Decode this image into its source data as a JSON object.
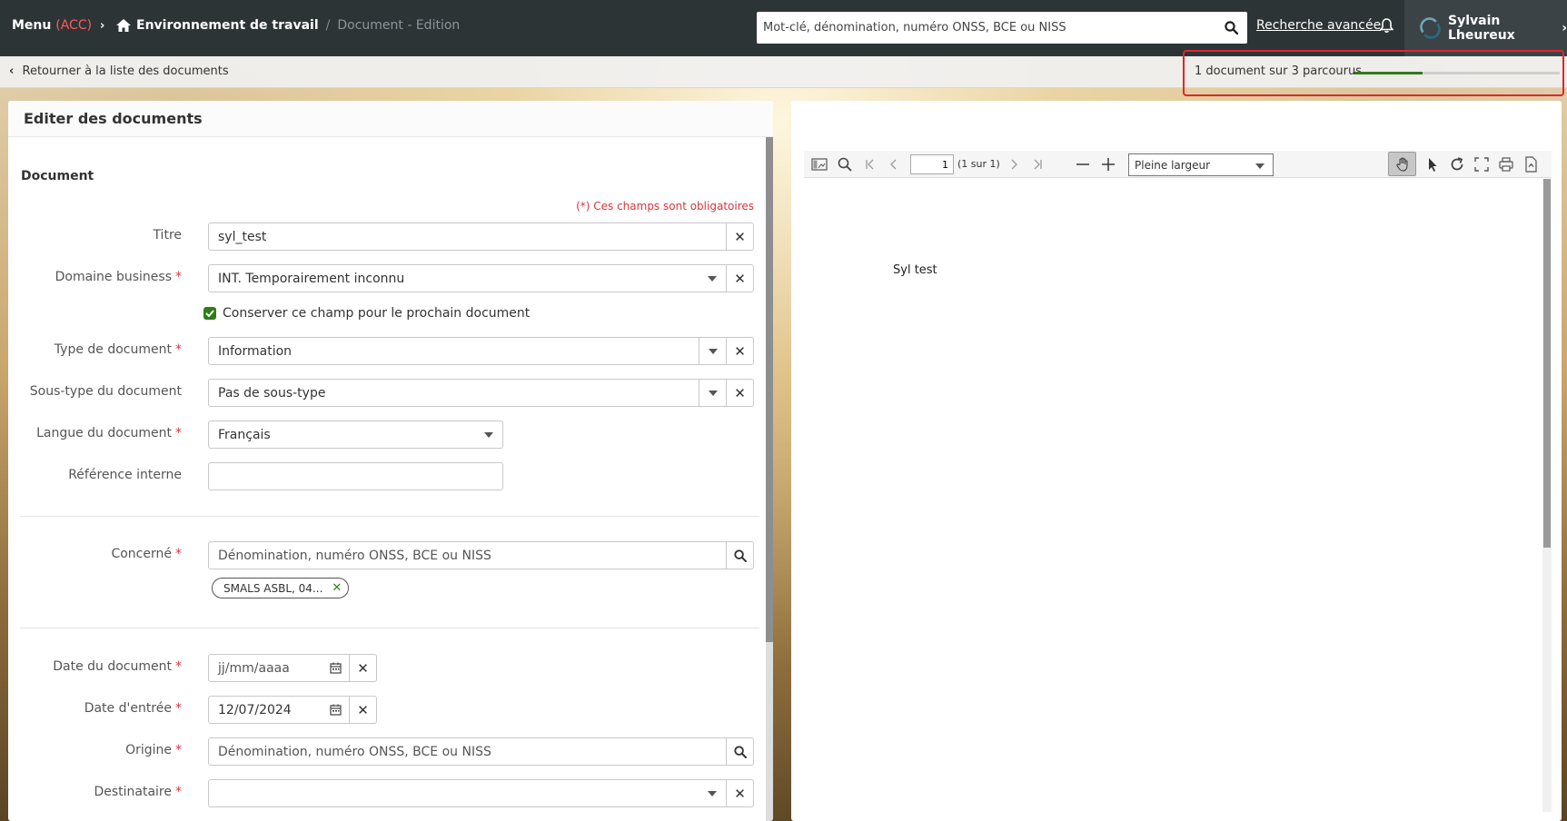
{
  "topbar": {
    "menu_label": "Menu",
    "env_tag": "(ACC)",
    "breadcrumb_workspace": "Environnement de travail",
    "breadcrumb_separator": "/",
    "breadcrumb_current": "Document - Edition",
    "search_placeholder": "Mot-clé, dénomination, numéro ONSS, BCE ou NISS",
    "advanced_search": "Recherche avancée",
    "user_name": "Sylvain Lheureux"
  },
  "subbar": {
    "back_label": "Retourner à la liste des documents",
    "progress_text": "1 document sur 3 parcourus",
    "progress_fraction": 0.3333,
    "progress_color": "#2e7d1a"
  },
  "form": {
    "panel_title": "Editer des documents",
    "section_title": "Document",
    "required_note": "(*) Ces champs sont obligatoires",
    "required_marker": "*",
    "fields": {
      "titre": {
        "label": "Titre",
        "value": "syl_test"
      },
      "domaine": {
        "label": "Domaine business",
        "value": "INT. Temporairement inconnu"
      },
      "keep_field": {
        "label": "Conserver ce champ pour le prochain document",
        "checked": true
      },
      "type": {
        "label": "Type de document",
        "value": "Information"
      },
      "sous_type": {
        "label": "Sous-type du document",
        "value": "Pas de sous-type"
      },
      "langue": {
        "label": "Langue du document",
        "value": "Français"
      },
      "reference": {
        "label": "Référence interne",
        "value": ""
      },
      "concerne": {
        "label": "Concerné",
        "placeholder": "Dénomination, numéro ONSS, BCE ou NISS",
        "tag": "SMALS ASBL, 04..."
      },
      "date_document": {
        "label": "Date du document",
        "placeholder": "jj/mm/aaaa"
      },
      "date_entree": {
        "label": "Date d'entrée",
        "value": "12/07/2024"
      },
      "origine": {
        "label": "Origine",
        "placeholder": "Dénomination, numéro ONSS, BCE ou NISS"
      },
      "destinataire": {
        "label": "Destinataire",
        "value": ""
      }
    }
  },
  "viewer": {
    "page_number": "1",
    "page_of": "(1 sur 1)",
    "zoom_level": "Pleine largeur",
    "document_text": "Syl test"
  },
  "colors": {
    "accent_green": "#2e7d1a",
    "required_red": "#d9363e",
    "topbar_bg": "#2d3436"
  }
}
